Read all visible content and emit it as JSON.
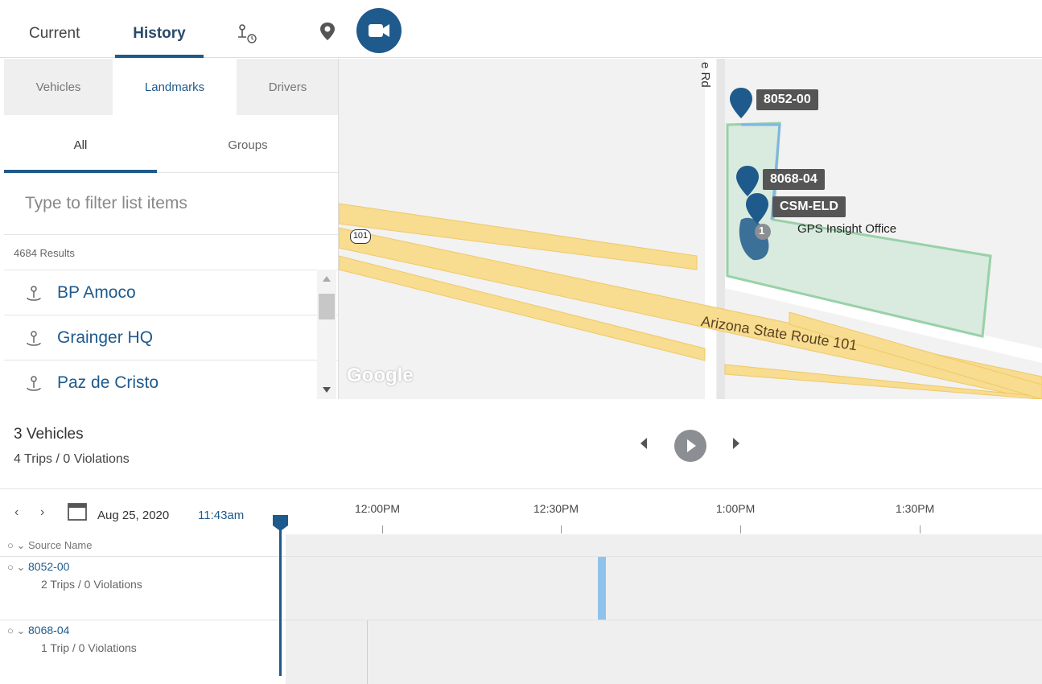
{
  "topbar": {
    "tabs": [
      {
        "label": "Current"
      },
      {
        "label": "History"
      }
    ],
    "icons": [
      "route-timer-icon",
      "map-pin-icon",
      "video-camera-icon"
    ],
    "accent": "#1f5a8c"
  },
  "leftpanel": {
    "subtabs": [
      "Vehicles",
      "Landmarks",
      "Drivers"
    ],
    "filtertabs": [
      "All",
      "Groups"
    ],
    "filter_placeholder": "Type to filter list items",
    "results": "4684 Results",
    "items": [
      {
        "label": "BP Amoco",
        "icon": "landmark-icon"
      },
      {
        "label": "Grainger HQ",
        "icon": "landmark-icon"
      },
      {
        "label": "Paz de Cristo",
        "icon": "landmark-icon"
      }
    ]
  },
  "map": {
    "vehicles": [
      "8052-00",
      "8068-04",
      "CSM-ELD"
    ],
    "place_label": "GPS Insight Office",
    "road_label": "Arizona State Route 101",
    "road_shield": "101",
    "street_fragment": "e Rd",
    "cluster_badge": "1",
    "attribution": "Google"
  },
  "summary": {
    "title": "3 Vehicles",
    "subtitle": "4 Trips / 0 Violations"
  },
  "timeline": {
    "date": "Aug 25, 2020",
    "time": "11:43am",
    "ticks": [
      "12:00PM",
      "12:30PM",
      "1:00PM",
      "1:30PM"
    ],
    "header_label": "Source Name",
    "rows": [
      {
        "name": "8052-00",
        "sub": "2 Trips / 0 Violations"
      },
      {
        "name": "8068-04",
        "sub": "1 Trip / 0 Violations"
      }
    ]
  }
}
